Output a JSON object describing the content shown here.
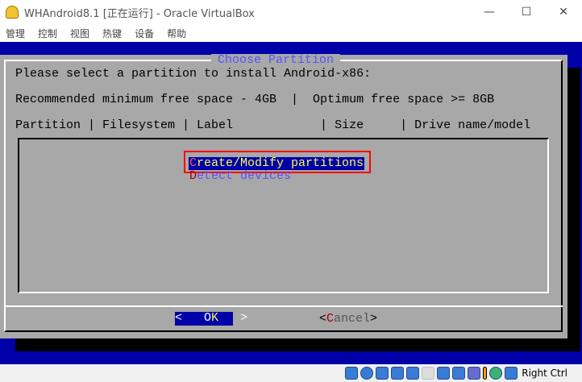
{
  "window": {
    "title": "WHAndroid8.1 [正在运行] - Oracle VirtualBox",
    "minimize": "—",
    "maximize": "☐",
    "close": "✕"
  },
  "menu": [
    "管理",
    "控制",
    "视图",
    "热键",
    "设备",
    "帮助"
  ],
  "dialog": {
    "title": "Choose Partition",
    "prompt": "Please select a partition to install Android-x86:",
    "space_info": "Recommended minimum free space - 4GB  |  Optimum free space >= 8GB",
    "columns": "Partition | Filesystem | Label            | Size     | Drive name/model",
    "items": [
      {
        "hotkey": "C",
        "rest": "reate/Modify partitions",
        "selected": true
      },
      {
        "hotkey": "D",
        "rest": "etect devices",
        "selected": false
      }
    ],
    "ok": {
      "left": "<",
      "hot": "",
      "label": "O",
      "hotkey": "K",
      "right": ">"
    },
    "cancel": {
      "left": "<",
      "hotkey": "C",
      "rest": "ancel",
      "right": ">"
    }
  },
  "status": {
    "icons": [
      "hdd-icon",
      "optical-icon",
      "audio-icon",
      "network-icon",
      "usb-icon",
      "shared-folder-icon",
      "display-icon",
      "capture-icon",
      "recording-icon",
      "cpu-icon",
      "mouse-integration-icon"
    ],
    "host_key": "Right Ctrl"
  },
  "colors": {
    "vm_bg": "#0000a8",
    "dialog": "#a8a8a8",
    "highlight": "#ff0000"
  }
}
